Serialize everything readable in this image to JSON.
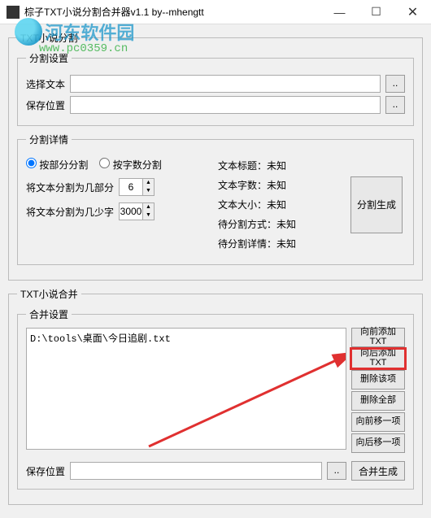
{
  "window": {
    "title": "棕子TXT小说分割合并器v1.1      by--mhengtt",
    "min": "—",
    "max": "☐",
    "close": "✕"
  },
  "watermark": {
    "text1": "河东软件园",
    "text2": "www.pc0359.cn"
  },
  "split": {
    "group_label": "TXT小说分割",
    "settings_label": "分割设置",
    "select_text_label": "选择文本",
    "select_text_value": "",
    "save_path_label": "保存位置",
    "save_path_value": "",
    "browse_label": "..",
    "detail_label": "分割详情",
    "radio_by_part": "按部分分割",
    "radio_by_chars": "按字数分割",
    "parts_label": "将文本分割为几部分",
    "parts_value": "6",
    "chars_label": "将文本分割为几少字",
    "chars_value": "3000",
    "info_title_label": "文本标题：",
    "info_title_value": "未知",
    "info_chars_label": "文本字数：",
    "info_chars_value": "未知",
    "info_size_label": "文本大小：",
    "info_size_value": "未知",
    "info_method_label": "待分割方式：",
    "info_method_value": "未知",
    "info_detail_label": "待分割详情：",
    "info_detail_value": "未知",
    "generate_label": "分割生成"
  },
  "merge": {
    "group_label": "TXT小说合并",
    "settings_label": "合并设置",
    "list_items": [
      "D:\\tools\\桌面\\今日追剧.txt"
    ],
    "btn_add_front": "向前添加TXT",
    "btn_add_back": "向后添加TXT",
    "btn_del_item": "删除该项",
    "btn_del_all": "删除全部",
    "btn_move_front": "向前移一项",
    "btn_move_back": "向后移一项",
    "save_path_label": "保存位置",
    "save_path_value": "",
    "browse_label": "..",
    "generate_label": "合并生成"
  }
}
